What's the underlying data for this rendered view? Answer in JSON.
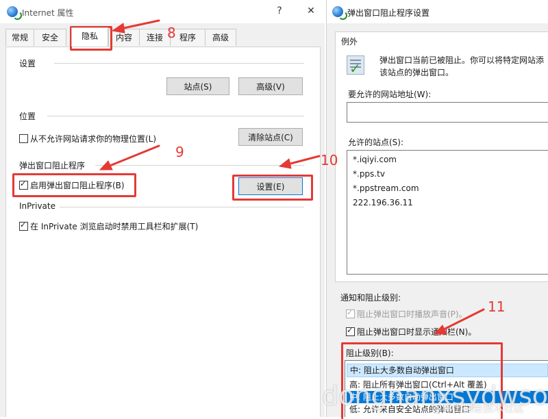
{
  "left_window": {
    "title": "Internet 属性",
    "help_button": "?",
    "close_button": "✕",
    "tabs": [
      "常规",
      "安全",
      "隐私",
      "内容",
      "连接",
      "程序",
      "高级"
    ],
    "active_tab": "隐私",
    "settings_group": "设置",
    "sites_button": "站点(S)",
    "advanced_button": "高级(V)",
    "location_group": "位置",
    "location_checkbox": "从不允许网站请求你的物理位置(L)",
    "clear_sites_button": "清除站点(C)",
    "popup_group": "弹出窗口阻止程序",
    "popup_checkbox": "启用弹出窗口阻止程序(B)",
    "popup_settings_button": "设置(E)",
    "inprivate_group": "InPrivate",
    "inprivate_checkbox": "在 InPrivate 浏览启动时禁用工具栏和扩展(T)"
  },
  "right_window": {
    "title": "弹出窗口阻止程序设置",
    "close_button": "✕",
    "exceptions_group": "例外",
    "exceptions_text_line1": "弹出窗口当前已被阻止。你可以将特定网站添",
    "exceptions_text_line2": "该站点的弹出窗口。",
    "address_label": "要允许的网站地址(W):",
    "address_value": "",
    "allowed_label": "允许的站点(S):",
    "allowed_sites": [
      "*.iqiyi.com",
      "*.pps.tv",
      "*.ppstream.com",
      "222.196.36.11"
    ],
    "notify_group": "通知和阻止级别:",
    "sound_checkbox": "阻止弹出窗口时播放声音(P)。",
    "infobar_checkbox": "阻止弹出窗口时显示通知栏(N)。",
    "level_label": "阻止级别(B):",
    "level_options": [
      "中: 阻止大多数自动弹出窗口",
      "高: 阻止所有弹出窗口(Ctrl+Alt 覆盖)",
      "中: 阻止大多数自动弹出窗口",
      "低: 允许来自安全站点的弹出窗口"
    ]
  },
  "annotations": [
    "8",
    "9",
    "10",
    "11"
  ],
  "watermark": {
    "large": "dongnanxsydwson",
    "small": "@稀土掘金技术社区"
  },
  "colors": {
    "annotation_red": "#e53935",
    "selection_blue": "#cce8ff",
    "focus_blue": "#0078d7"
  }
}
